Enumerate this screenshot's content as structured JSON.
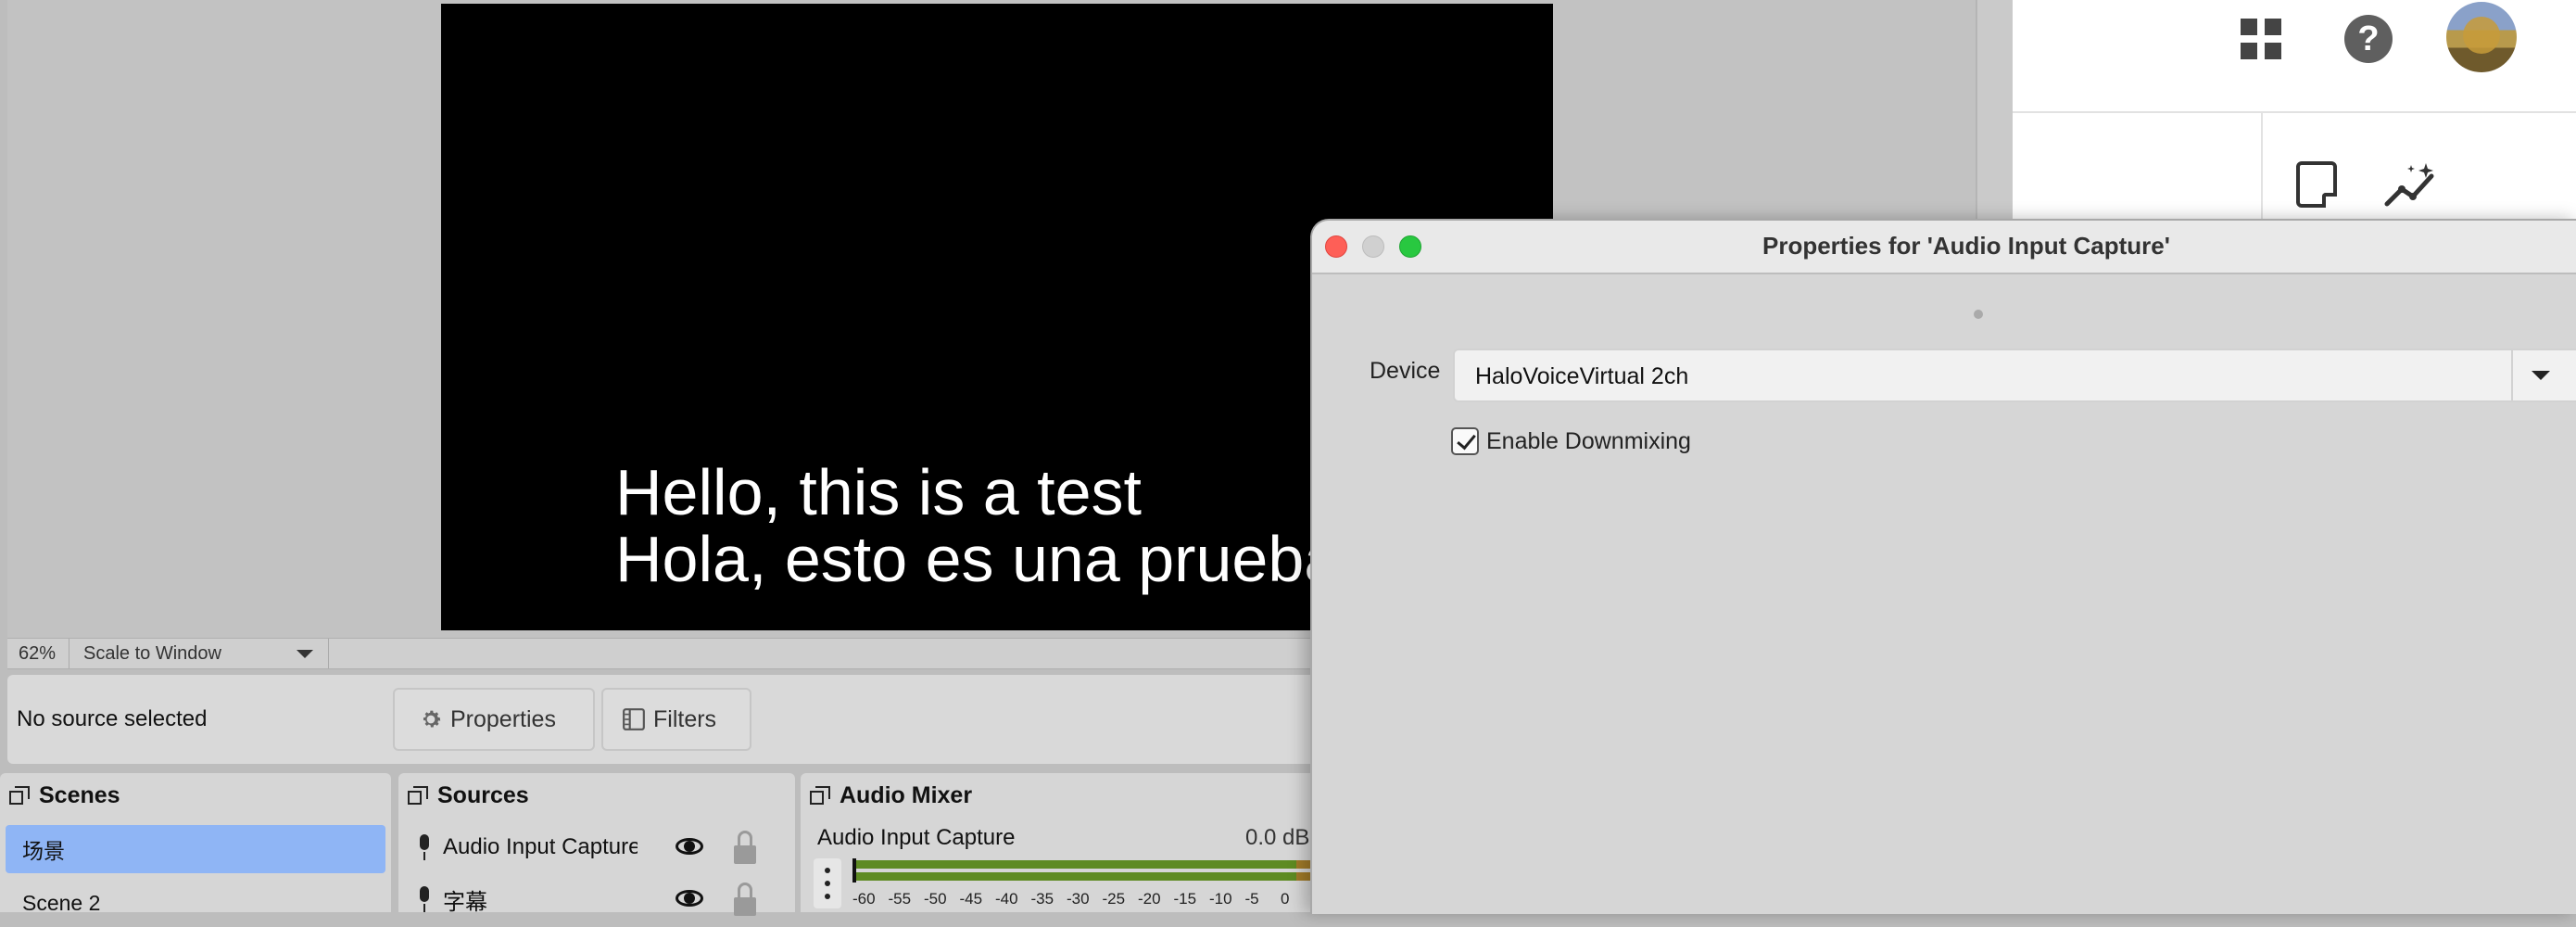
{
  "preview": {
    "subtitle_line_1": "Hello, this is a test",
    "subtitle_line_2": "Hola, esto es una prueba"
  },
  "zoom_bar": {
    "zoom": "62%",
    "mode": "Scale to Window"
  },
  "context_bar": {
    "status": "No source selected",
    "properties_label": "Properties",
    "filters_label": "Filters"
  },
  "scenes": {
    "title": "Scenes",
    "items": [
      {
        "label": "场景",
        "selected": true
      },
      {
        "label": "Scene 2",
        "selected": false
      }
    ]
  },
  "sources": {
    "title": "Sources",
    "items": [
      {
        "label": "Audio Input Capture",
        "icon": "mic-icon"
      },
      {
        "label": "字幕",
        "icon": "text-icon"
      }
    ]
  },
  "mixer": {
    "title": "Audio Mixer",
    "track_name": "Audio Input Capture",
    "track_db": "0.0 dB",
    "ticks": [
      "-60",
      "-55",
      "-50",
      "-45",
      "-40",
      "-35",
      "-30",
      "-25",
      "-20",
      "-15",
      "-10",
      "-5",
      "0"
    ]
  },
  "dialog": {
    "title": "Properties for 'Audio Input Capture'",
    "device_label": "Device",
    "device_value": "HaloVoiceVirtual 2ch",
    "downmix_label": "Enable Downmixing",
    "downmix_checked": true
  },
  "colors": {
    "scene_selected": "#8fb5f5",
    "meter_green": "#5e8b22",
    "meter_yellow": "#a07a28",
    "meter_red": "#8a2c2c",
    "close": "#fe5f57",
    "maximize": "#28c840"
  }
}
